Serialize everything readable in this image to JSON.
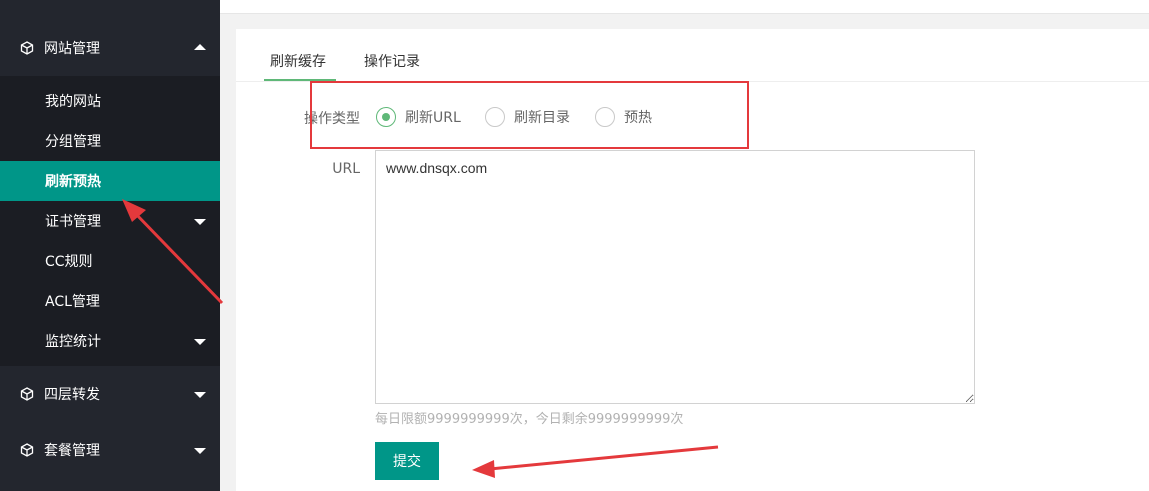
{
  "sidebar": {
    "groups": [
      {
        "label": "网站管理",
        "icon": "cube-icon",
        "expanded": true
      },
      {
        "label": "四层转发",
        "icon": "cube-icon",
        "expanded": false
      },
      {
        "label": "套餐管理",
        "icon": "cube-icon",
        "expanded": false
      }
    ],
    "items": [
      {
        "label": "我的网站"
      },
      {
        "label": "分组管理"
      },
      {
        "label": "刷新预热",
        "active": true
      },
      {
        "label": "证书管理",
        "has_children": true
      },
      {
        "label": "CC规则"
      },
      {
        "label": "ACL管理"
      },
      {
        "label": "监控统计",
        "has_children": true
      }
    ]
  },
  "tabs": [
    {
      "label": "刷新缓存",
      "active": true
    },
    {
      "label": "操作记录"
    }
  ],
  "form": {
    "type_label": "操作类型",
    "options": [
      {
        "label": "刷新URL",
        "checked": true
      },
      {
        "label": "刷新目录"
      },
      {
        "label": "预热"
      }
    ],
    "url_label": "URL",
    "url_value": "www.dnsqx.com",
    "hint": "每日限额9999999999次，今日剩余9999999999次",
    "submit_label": "提交"
  },
  "colors": {
    "sidebar_bg": "#23262e",
    "active_item": "#009688",
    "radio_accent": "#5fb878",
    "annotation_red": "#e4393c"
  }
}
